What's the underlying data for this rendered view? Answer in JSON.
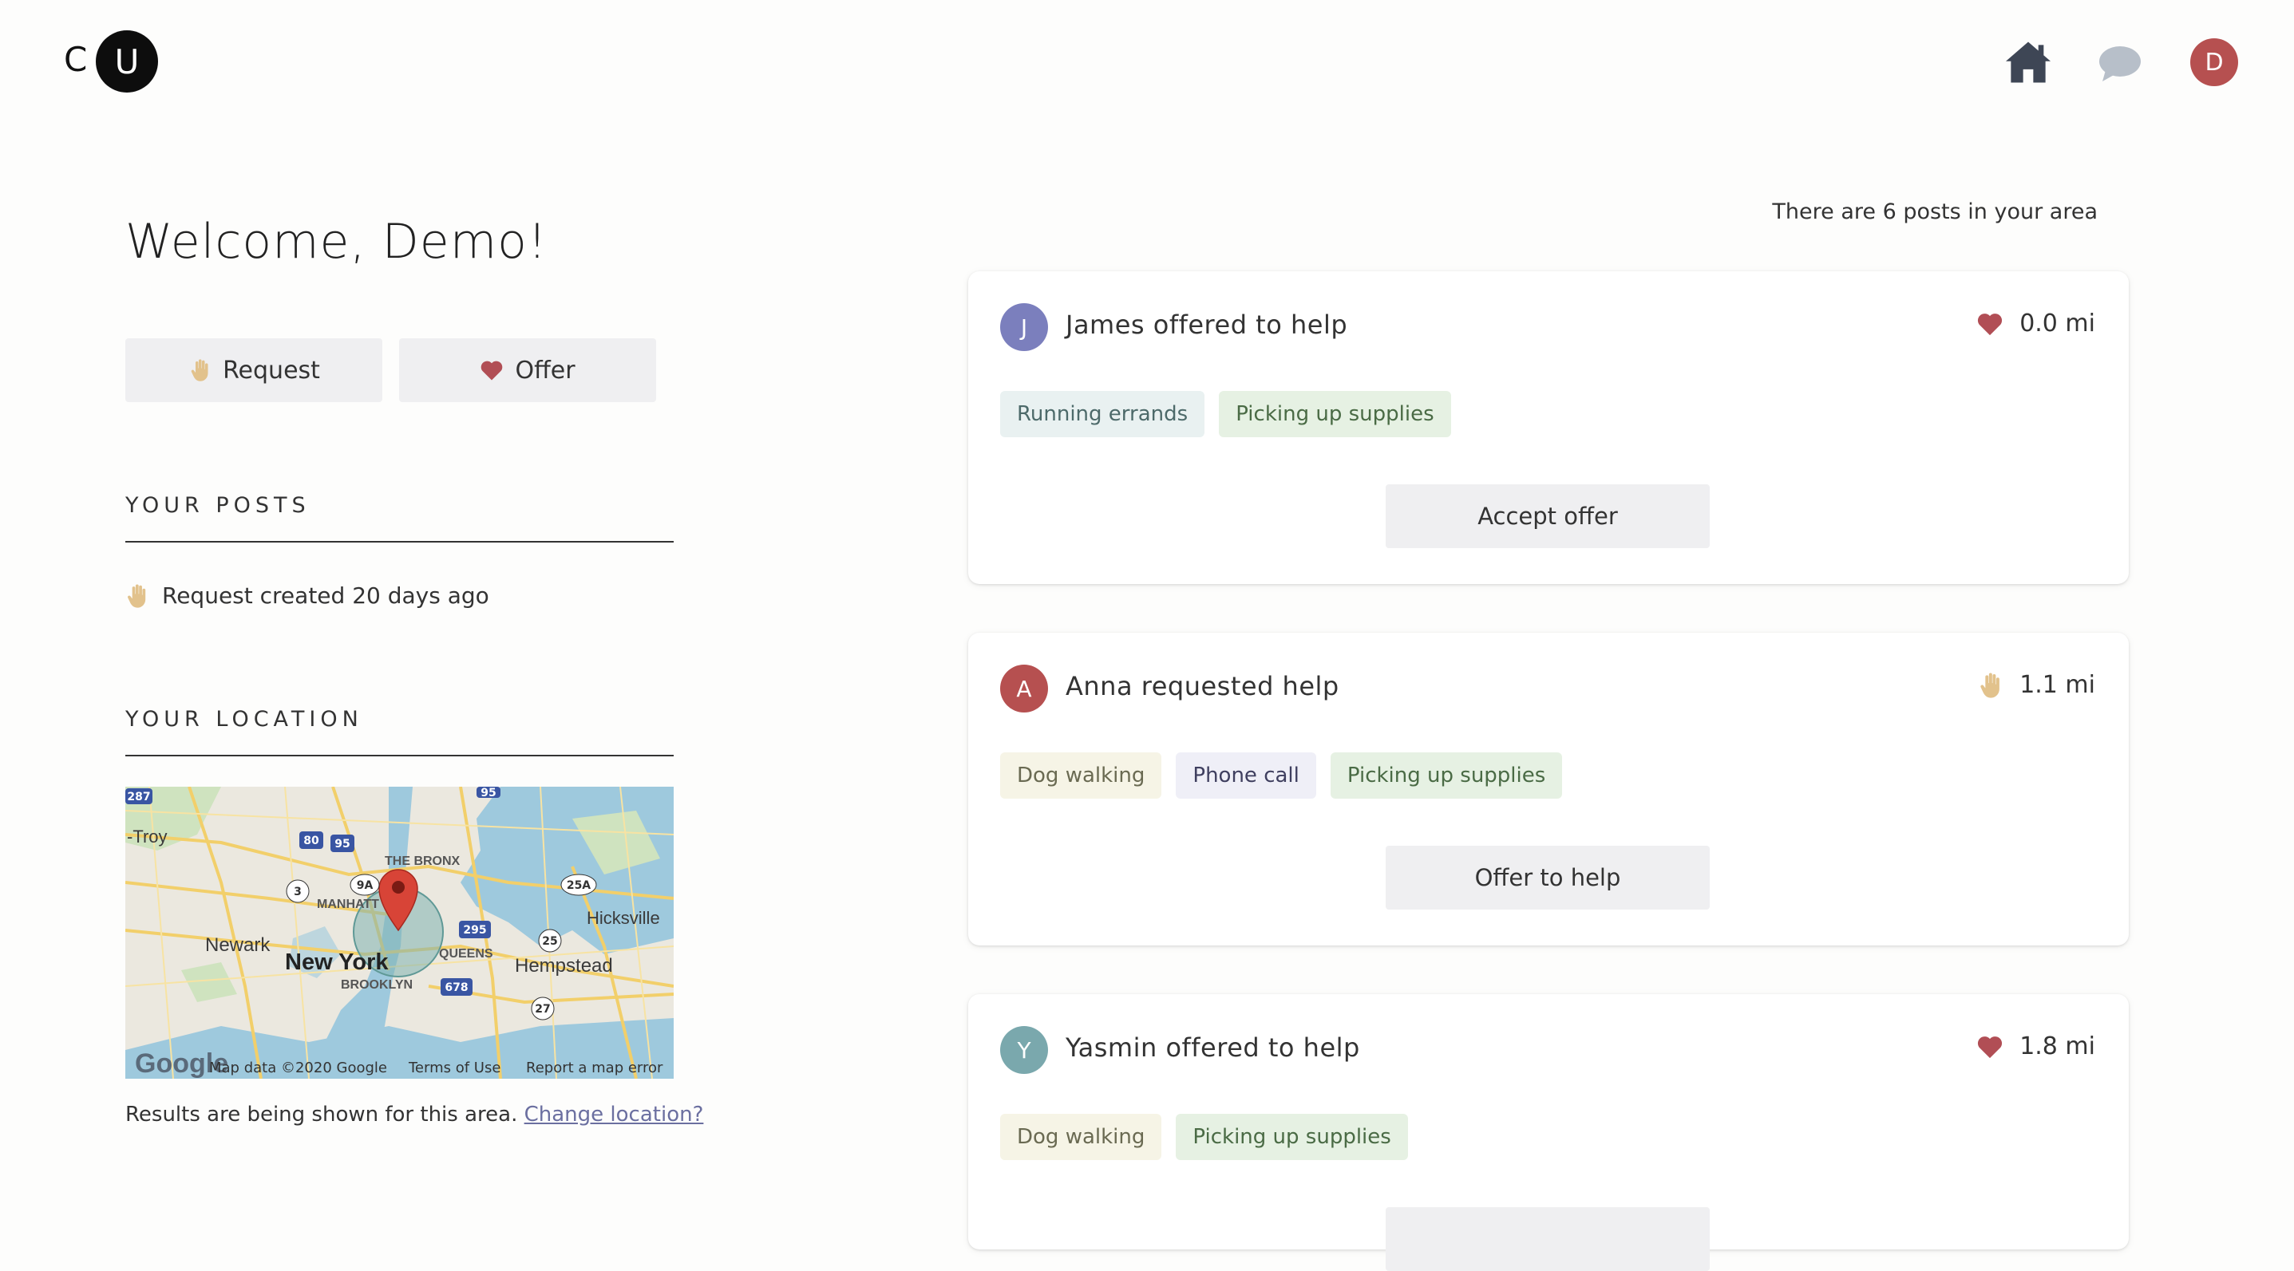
{
  "header": {
    "logo_c": "C",
    "logo_u": "U",
    "nav": {
      "home_icon": "home-icon",
      "chat_icon": "chat-bubble-icon",
      "avatar_initial": "D"
    }
  },
  "welcome": "Welcome, Demo!",
  "actions": {
    "request_label": "Request",
    "offer_label": "Offer"
  },
  "your_posts": {
    "heading": "YOUR POSTS",
    "items": [
      {
        "icon": "raised-hand-icon",
        "text": "Request created 20 days ago"
      }
    ]
  },
  "your_location": {
    "heading": "YOUR LOCATION",
    "map": {
      "labels": {
        "troy": "-Troy",
        "bronx": "THE BRONX",
        "manhattan": "MANHATT",
        "newark": "Newark",
        "new_york": "New York",
        "brooklyn": "BROOKLYN",
        "queens": "QUEENS",
        "hicksville": "Hicksville",
        "hempstead": "Hempstead"
      },
      "shields": [
        "287",
        "80",
        "95",
        "3",
        "9A",
        "25A",
        "295",
        "25",
        "678",
        "27",
        "95"
      ],
      "google_logo": "Google",
      "attribution": {
        "data": "Map data ©2020 Google",
        "terms": "Terms of Use",
        "report": "Report a map error"
      }
    },
    "results_text": "Results are being shown for this area.",
    "change_link": "Change location?"
  },
  "feed": {
    "count_text": "There are 6 posts in your area",
    "posts": [
      {
        "initial": "J",
        "avatar_color": "#7b7fbd",
        "title": "James offered to help",
        "kind": "offer",
        "distance": "0.0 mi",
        "tags": [
          {
            "label": "Running errands",
            "style": "errand"
          },
          {
            "label": "Picking up supplies",
            "style": "supplies"
          }
        ],
        "action": "Accept offer"
      },
      {
        "initial": "A",
        "avatar_color": "#b65050",
        "title": "Anna requested help",
        "kind": "request",
        "distance": "1.1 mi",
        "tags": [
          {
            "label": "Dog walking",
            "style": "dog"
          },
          {
            "label": "Phone call",
            "style": "phone"
          },
          {
            "label": "Picking up supplies",
            "style": "supplies"
          }
        ],
        "action": "Offer to help"
      },
      {
        "initial": "Y",
        "avatar_color": "#7aa8ad",
        "title": "Yasmin offered to help",
        "kind": "offer",
        "distance": "1.8 mi",
        "tags": [
          {
            "label": "Dog walking",
            "style": "dog"
          },
          {
            "label": "Picking up supplies",
            "style": "supplies"
          }
        ],
        "action": ""
      }
    ]
  },
  "colors": {
    "heart": "#b14e55",
    "hand": "#e2c28c",
    "accent": "#b65050"
  }
}
